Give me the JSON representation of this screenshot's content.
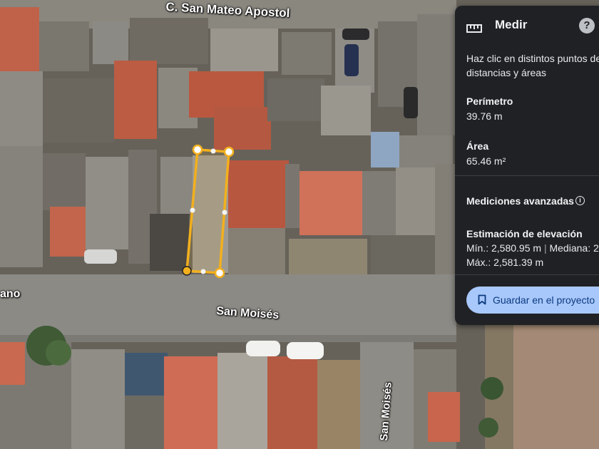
{
  "map": {
    "street_labels": {
      "top": "C. San Mateo Apostol",
      "left": "ano",
      "main": "San Moisés",
      "vertical": "San Moisés"
    }
  },
  "measure_panel": {
    "title": "Medir",
    "ruler_icon": "ruler-icon",
    "help_icon": "?",
    "instructions": "Haz clic en distintos puntos de distancias y áreas",
    "perimeter_label": "Perímetro",
    "perimeter_value": "39.76 m",
    "area_label": "Área",
    "area_value": "65.46 m²",
    "advanced_label": "Mediciones avanzadas",
    "info_icon": "i",
    "elevation_label": "Estimación de elevación",
    "elevation_min_label": "Mín.: 2,580.95 m",
    "elevation_separator": "|",
    "elevation_median_label": "Mediana: 2,",
    "elevation_max_label": "Máx.: 2,581.39 m",
    "save_button": "Guardar en el proyecto",
    "save_icon": "bookmark-icon"
  },
  "colors": {
    "measurement_line": "#f2b01e",
    "panel_bg": "#202124",
    "save_button_bg": "#a8c7fa"
  }
}
